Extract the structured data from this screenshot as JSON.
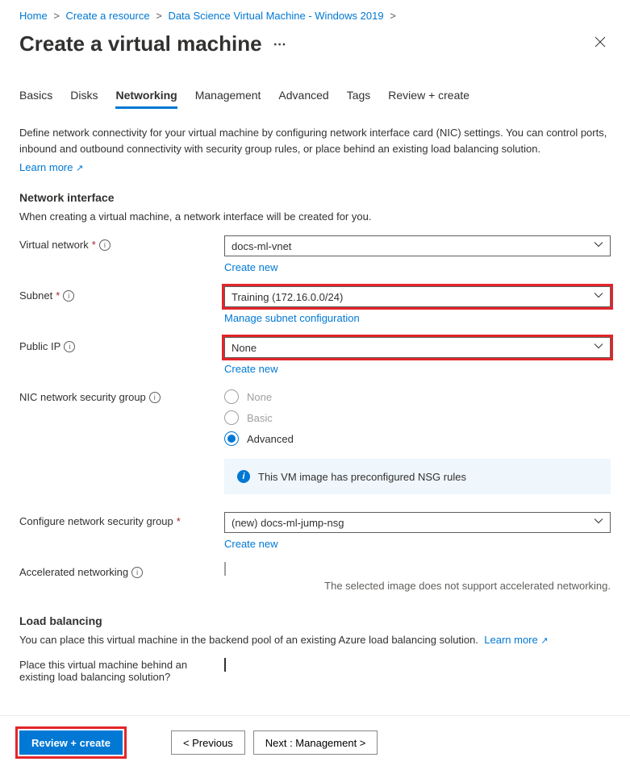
{
  "breadcrumb": {
    "home": "Home",
    "create_resource": "Create a resource",
    "product": "Data Science Virtual Machine - Windows 2019"
  },
  "header": {
    "title": "Create a virtual machine"
  },
  "tabs": {
    "basics": "Basics",
    "disks": "Disks",
    "networking": "Networking",
    "management": "Management",
    "advanced": "Advanced",
    "tags": "Tags",
    "review": "Review + create"
  },
  "intro": {
    "text": "Define network connectivity for your virtual machine by configuring network interface card (NIC) settings. You can control ports, inbound and outbound connectivity with security group rules, or place behind an existing load balancing solution.",
    "learn_more": "Learn more"
  },
  "ni": {
    "heading": "Network interface",
    "sub": "When creating a virtual machine, a network interface will be created for you."
  },
  "fields": {
    "vnet_label": "Virtual network",
    "vnet_value": "docs-ml-vnet",
    "vnet_create": "Create new",
    "subnet_label": "Subnet",
    "subnet_value": "Training (172.16.0.0/24)",
    "subnet_manage": "Manage subnet configuration",
    "pip_label": "Public IP",
    "pip_value": "None",
    "pip_create": "Create new",
    "nsg_label": "NIC network security group",
    "nsg_opts": {
      "none": "None",
      "basic": "Basic",
      "advanced": "Advanced"
    },
    "nsg_banner": "This VM image has preconfigured NSG rules",
    "cfg_nsg_label": "Configure network security group",
    "cfg_nsg_value": "(new) docs-ml-jump-nsg",
    "cfg_nsg_create": "Create new",
    "accel_label": "Accelerated networking",
    "accel_helper": "The selected image does not support accelerated networking."
  },
  "lb": {
    "heading": "Load balancing",
    "sub": "You can place this virtual machine in the backend pool of an existing Azure load balancing solution.",
    "learn_more": "Learn more",
    "place_label": "Place this virtual machine behind an existing load balancing solution?"
  },
  "footer": {
    "review": "Review + create",
    "previous": "<  Previous",
    "next": "Next : Management  >"
  }
}
